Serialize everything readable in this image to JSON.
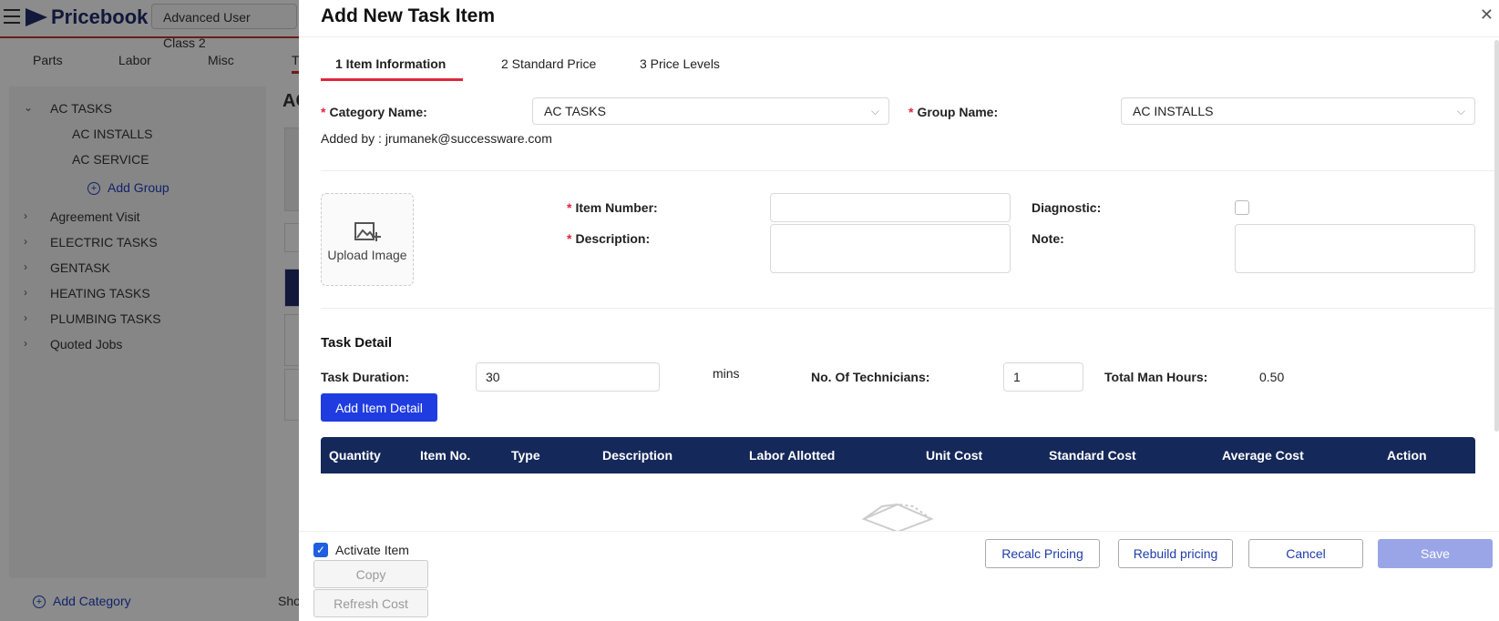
{
  "app": {
    "name": "Pricebook",
    "class_select": "Advanced User Class 2",
    "tabs": [
      "Parts",
      "Labor",
      "Misc",
      "T"
    ],
    "tree": {
      "expanded": "AC TASKS",
      "children": [
        "AC INSTALLS",
        "AC SERVICE"
      ],
      "add_group": "Add Group",
      "categories": [
        "Agreement Visit",
        "ELECTRIC TASKS",
        "GENTASK",
        "HEATING TASKS",
        "PLUMBING TASKS",
        "Quoted Jobs"
      ]
    },
    "add_category": "Add Category",
    "right_title": "AC",
    "show_label": "Sho"
  },
  "drawer": {
    "title": "Add New Task Item",
    "steps": [
      "1 Item Information",
      "2 Standard Price",
      "3 Price Levels"
    ],
    "category_label": "Category Name",
    "category_value": "AC TASKS",
    "group_label": "Group Name",
    "group_value": "AC INSTALLS",
    "added_by": "Added by : jrumanek@successware.com",
    "upload_label": "Upload Image",
    "item_number_label": "Item Number",
    "item_number_value": "",
    "description_label": "Description",
    "description_value": "",
    "diagnostic_label": "Diagnostic",
    "note_label": "Note",
    "note_value": "",
    "task_detail_title": "Task Detail",
    "task_duration_label": "Task Duration",
    "task_duration_value": "30",
    "mins_label": "mins",
    "technicians_label": "No. Of Technicians",
    "technicians_value": "1",
    "man_hours_label": "Total Man Hours",
    "man_hours_value": "0.50",
    "add_item_detail": "Add Item Detail",
    "table_columns": [
      "Quantity",
      "Item No.",
      "Type",
      "Description",
      "Labor Allotted",
      "Unit Cost",
      "Standard Cost",
      "Average Cost",
      "Action"
    ],
    "activate_label": "Activate Item",
    "activate_checked": true,
    "copy": "Copy",
    "refresh_cost": "Refresh Cost",
    "recalc": "Recalc Pricing",
    "rebuild": "Rebuild pricing",
    "cancel": "Cancel",
    "save": "Save"
  },
  "colors": {
    "accent": "#1f3ce0",
    "header_navy": "#15285a",
    "required_red": "#e0263a",
    "brand_red": "#c0392b"
  }
}
